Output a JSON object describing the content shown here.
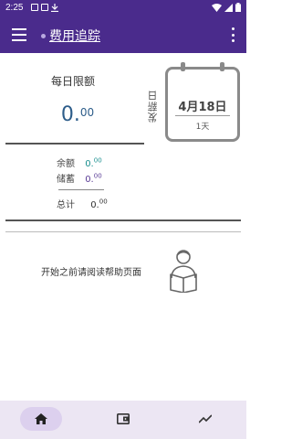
{
  "status_bar": {
    "time": "2:25",
    "icons": [
      "notification-box-icon",
      "image-icon",
      "download-icon",
      "wifi-icon",
      "signal-icon",
      "battery-icon"
    ]
  },
  "app_bar": {
    "title": "费用追踪",
    "menu_icon": "menu-icon",
    "more_icon": "more-vert-icon"
  },
  "daily": {
    "label": "每日限额",
    "amount_int": "0.",
    "amount_dec": "00"
  },
  "summary": {
    "balance_label": "余额",
    "balance_int": "0.",
    "balance_dec": "00",
    "savings_label": "储蓄",
    "savings_int": "0.",
    "savings_dec": "00",
    "total_label": "总计",
    "total_int": "0.",
    "total_dec": "00"
  },
  "payday": {
    "label": "发薪日",
    "date": "4月18日",
    "days": "1天"
  },
  "help": {
    "text": "开始之前请阅读帮助页面",
    "icon": "reader-icon"
  },
  "bottom_nav": {
    "items": [
      {
        "icon": "home-icon",
        "active": true
      },
      {
        "icon": "wallet-icon",
        "active": false
      },
      {
        "icon": "trending-icon",
        "active": false
      }
    ]
  },
  "colors": {
    "primary": "#4a2b8c",
    "amount_blue": "#2d5d8a",
    "teal": "#1a8f8f",
    "purple": "#5a3c96",
    "nav_bg": "#ece6f3",
    "nav_active": "#dcd0ee"
  }
}
